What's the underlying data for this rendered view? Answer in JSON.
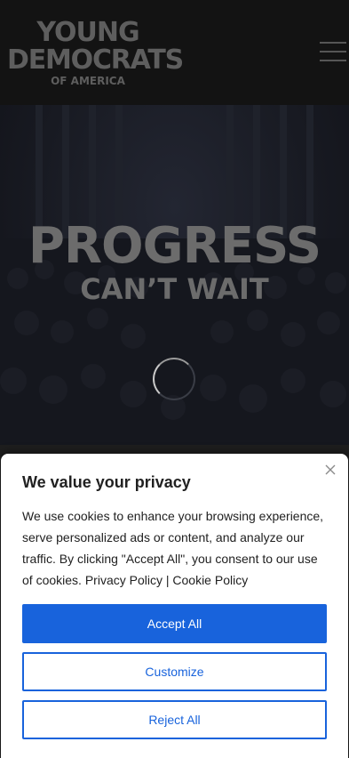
{
  "brand": {
    "line1": "YOUNG",
    "line2": "DEMOCRATS",
    "line3": "OF AMERICA"
  },
  "hero": {
    "headline": "PROGRESS",
    "subheadline": "CAN’T WAIT"
  },
  "cookie_banner": {
    "title": "We value your privacy",
    "body": "We use cookies to enhance your browsing experience, serve personalized ads or content, and analyze our traffic. By clicking \"Accept All\", you consent to our use of cookies.",
    "privacy_link": "Privacy Policy",
    "separator": "|",
    "cookie_link": "Cookie Policy",
    "accept_label": "Accept All",
    "customize_label": "Customize",
    "reject_label": "Reject All"
  },
  "colors": {
    "accent": "#1863dc",
    "header_bg": "#131313",
    "logo_gray": "#5e5e5e"
  },
  "icons": {
    "menu": "hamburger-menu-icon",
    "close": "close-icon",
    "loading": "loading-spinner-icon"
  }
}
